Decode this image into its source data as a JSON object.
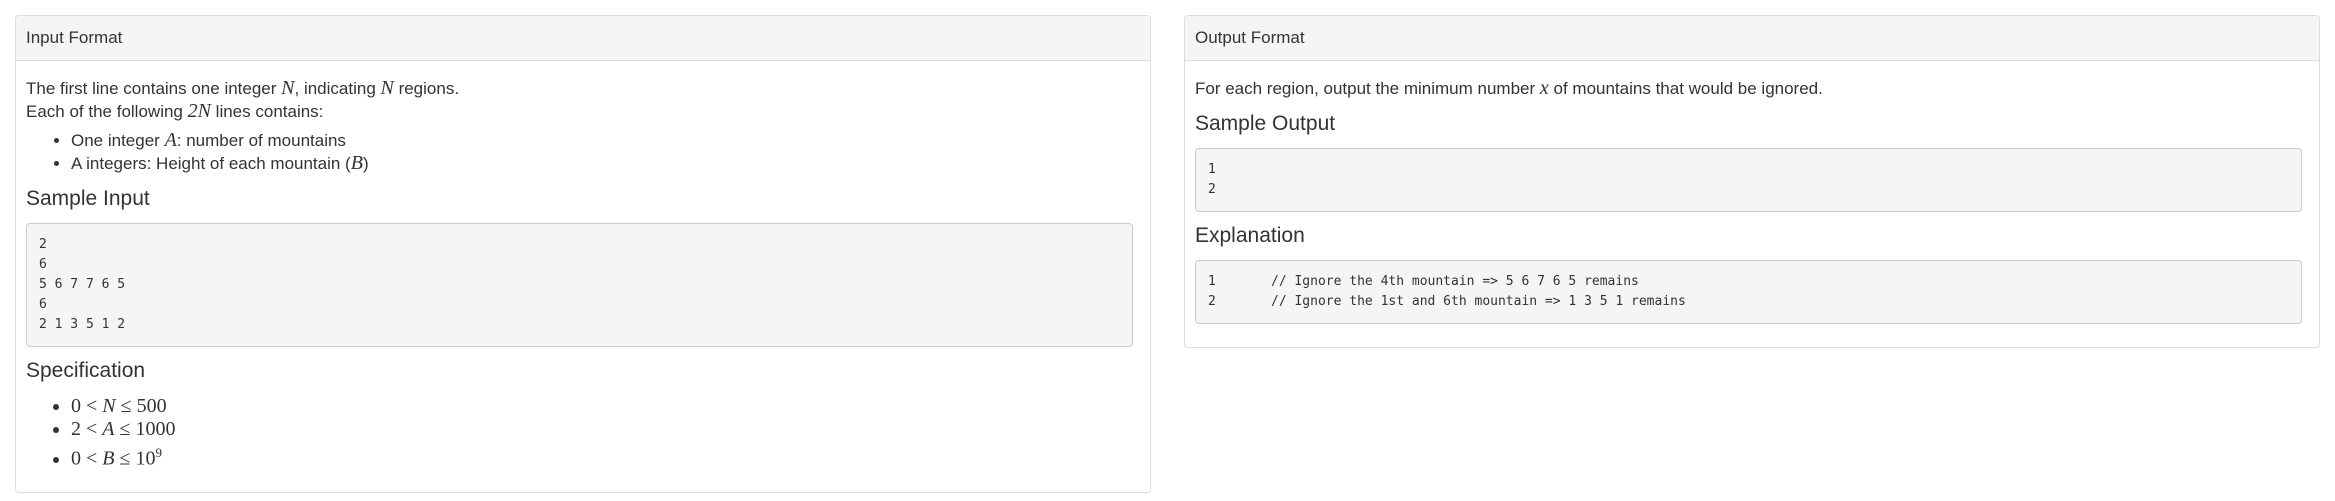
{
  "input_panel": {
    "title": "Input Format",
    "line1_pre": "The first line contains one integer ",
    "line1_var1": "N",
    "line1_mid": ", indicating ",
    "line1_var2": "N",
    "line1_post": " regions.",
    "line2_pre": "Each of the following ",
    "line2_var": "2N",
    "line2_post": " lines contains:",
    "bullets": [
      {
        "pre": "One integer ",
        "var": "A",
        "post": ": number of mountains"
      },
      {
        "pre": "A integers: Height of each mountain (",
        "var": "B",
        "post": ")"
      }
    ],
    "sample_input_title": "Sample Input",
    "sample_input_lines": [
      "2",
      "6",
      "5 6 7 7 6 5",
      "6",
      "2 1 3 5 1 2"
    ],
    "specification_title": "Specification",
    "spec": [
      {
        "lo": "0",
        "var": "N",
        "hi": "500"
      },
      {
        "lo": "2",
        "var": "A",
        "hi": "1000"
      },
      {
        "lo": "0",
        "var": "B",
        "hi": "10",
        "exp": "9"
      }
    ]
  },
  "output_panel": {
    "title": "Output Format",
    "desc_pre": "For each region, output the minimum number ",
    "desc_var": "x",
    "desc_post": " of mountains that would be ignored.",
    "sample_output_title": "Sample Output",
    "sample_output_lines": [
      "1",
      "2"
    ],
    "explanation_title": "Explanation",
    "explanation_rows": [
      {
        "num": "1",
        "text": "// Ignore the 4th mountain => 5 6 7 6 5 remains"
      },
      {
        "num": "2",
        "text": "// Ignore the 1st and 6th mountain => 1 3 5 1 remains"
      }
    ]
  }
}
